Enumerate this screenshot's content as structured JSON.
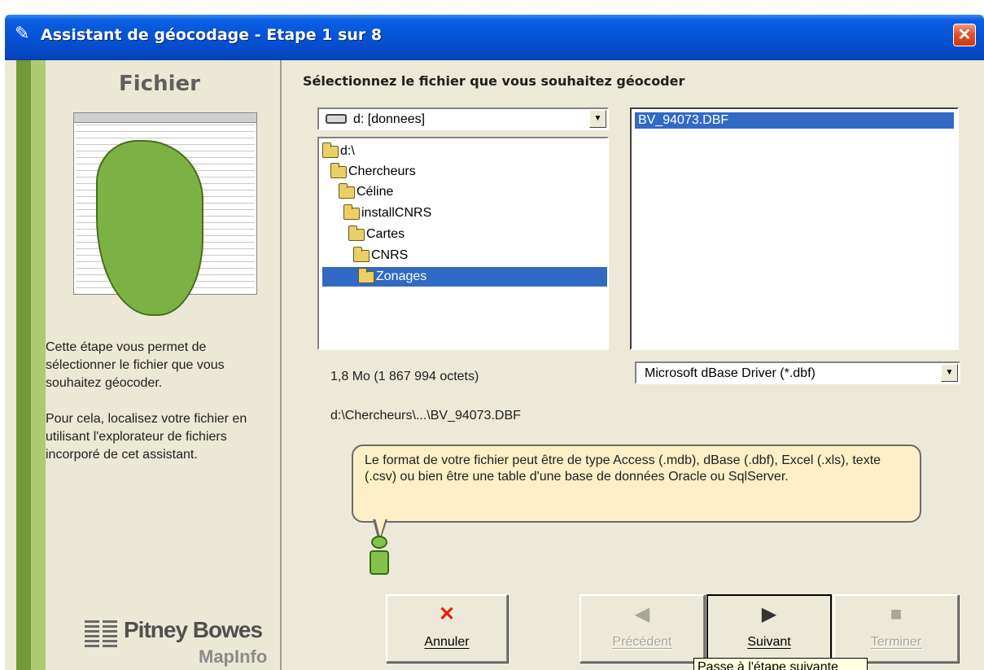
{
  "window": {
    "title": "Assistant de géocodage - Etape 1 sur 8",
    "close_label": "✕"
  },
  "left_panel": {
    "title": "Fichier",
    "paragraph1": "Cette étape vous permet de sélectionner le fichier que vous souhaitez géocoder.",
    "paragraph2": "Pour cela, localisez votre fichier en utilisant l'explorateur de fichiers incorporé de cet assistant.",
    "logo_name": "Pitney Bowes",
    "logo_sub": "MapInfo"
  },
  "main": {
    "heading": "Sélectionnez le fichier que vous souhaitez géocoder",
    "drive": "d: [donnees]",
    "directories": [
      {
        "label": "d:\\",
        "selected": false
      },
      {
        "label": "Chercheurs",
        "selected": false
      },
      {
        "label": "Céline",
        "selected": false
      },
      {
        "label": "installCNRS",
        "selected": false
      },
      {
        "label": "Cartes",
        "selected": false
      },
      {
        "label": "CNRS",
        "selected": false
      },
      {
        "label": "Zonages",
        "selected": true
      }
    ],
    "files": [
      "BV_94073.DBF"
    ],
    "file_size": "1,8 Mo (1 867 994 octets)",
    "file_path": "d:\\Chercheurs\\...\\BV_94073.DBF",
    "driver": "Microsoft dBase Driver (*.dbf)",
    "tip": "Le format de votre fichier peut être de type Access (.mdb), dBase (.dbf), Excel (.xls), texte (.csv) ou bien être une table d'une base de données Oracle ou SqlServer."
  },
  "buttons": {
    "cancel": "Annuler",
    "previous": "Précédent",
    "next": "Suivant",
    "finish": "Terminer"
  },
  "tooltip": "Passe à l'étape suivante",
  "colors": {
    "title_bar": "#0553d6",
    "selection": "#316ac5",
    "panel_green": "#6f9a36",
    "tip_background": "#fdefc6",
    "cancel_icon": "#e8200c"
  },
  "icons": {
    "title": "wizard-wand-icon",
    "close": "close-icon",
    "drive": "hard-drive-icon",
    "folder": "folder-open-icon",
    "info": "info-person-icon",
    "cancel": "red-x-icon",
    "previous": "arrow-left-icon",
    "next": "arrow-right-icon",
    "finish": "square-stop-icon"
  }
}
